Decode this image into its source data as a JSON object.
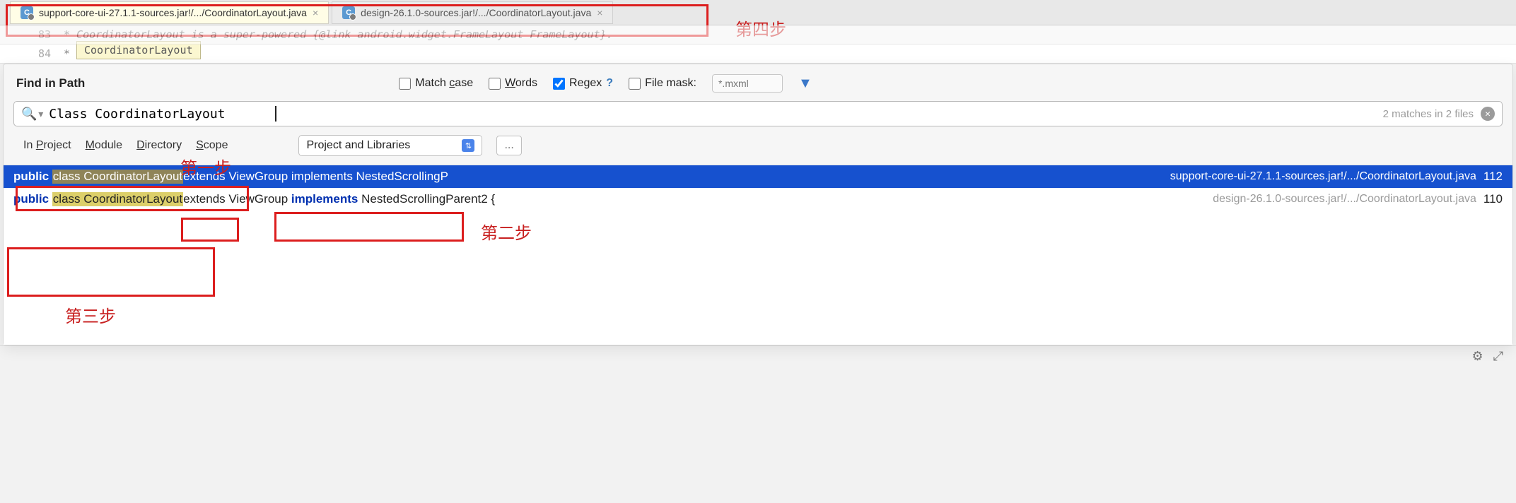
{
  "tabs": [
    {
      "label": "support-core-ui-27.1.1-sources.jar!/.../CoordinatorLayout.java",
      "active": true
    },
    {
      "label": "design-26.1.0-sources.jar!/.../CoordinatorLayout.java",
      "active": false
    }
  ],
  "tooltip": "CoordinatorLayout",
  "code": {
    "line_no": "84",
    "line_83_frag": "* CoordinatorLayout is a super-powered {@link android.widget.FrameLayout FrameLayout}.",
    "line_84": " *"
  },
  "annotations": {
    "step1": "第一步",
    "step2": "第二步",
    "step3": "第三步",
    "step4": "第四步"
  },
  "find": {
    "title": "Find in Path",
    "match_case": "Match case",
    "words": "Words",
    "regex": "Regex",
    "help": "?",
    "file_mask": "File mask:",
    "mask_placeholder": "*.mxml",
    "query": "Class CoordinatorLayout",
    "match_info": "2 matches in 2 files",
    "scope_tabs": {
      "project": "In Project",
      "module": "Module",
      "directory": "Directory",
      "scope": "Scope"
    },
    "scope_selected": "Project and Libraries",
    "dots": "..."
  },
  "results": [
    {
      "public": "public",
      "hl": "class CoordinatorLayout",
      "rest": " extends ViewGroup implements NestedScrollingP",
      "path": "support-core-ui-27.1.1-sources.jar!/.../CoordinatorLayout.java",
      "line": "112",
      "selected": true
    },
    {
      "public": "public",
      "hl": "class CoordinatorLayout",
      "rest": " extends ViewGroup implements NestedScrollingParent2 {",
      "path": "design-26.1.0-sources.jar!/.../CoordinatorLayout.java",
      "line": "110",
      "selected": false
    }
  ],
  "icons": {
    "class_badge": "C",
    "gear": "⚙",
    "overflow": "⤢"
  }
}
